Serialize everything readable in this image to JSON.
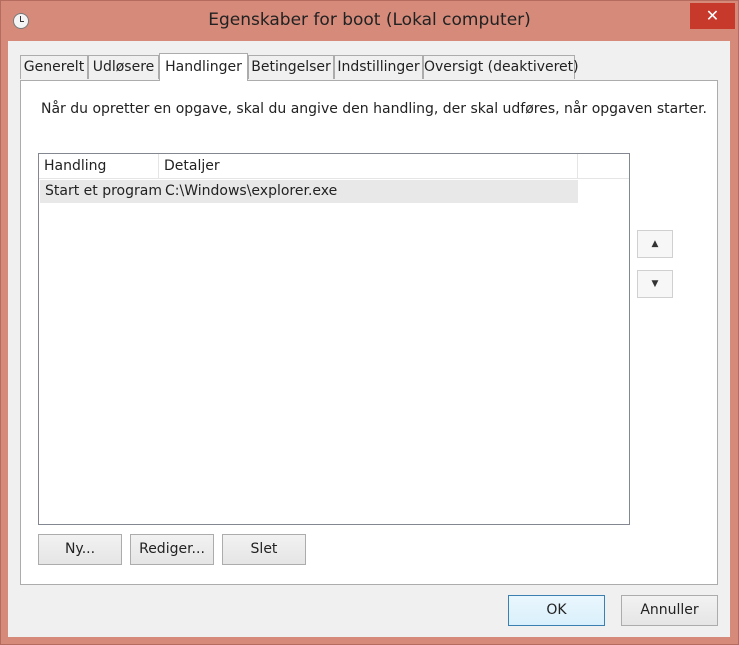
{
  "window": {
    "title": "Egenskaber for boot (Lokal computer)",
    "close_symbol": "✕"
  },
  "tabs": [
    {
      "label": "Generelt",
      "active": false
    },
    {
      "label": "Udløsere",
      "active": false
    },
    {
      "label": "Handlinger",
      "active": true
    },
    {
      "label": "Betingelser",
      "active": false
    },
    {
      "label": "Indstillinger",
      "active": false
    },
    {
      "label": "Oversigt (deaktiveret)",
      "active": false
    }
  ],
  "panel": {
    "description": "Når du opretter en opgave, skal du angive den handling, der skal udføres, når opgaven starter."
  },
  "actions_table": {
    "columns": [
      "Handling",
      "Detaljer"
    ],
    "rows": [
      {
        "action": "Start et program",
        "details": "C:\\Windows\\explorer.exe",
        "selected": true
      }
    ]
  },
  "move_buttons": {
    "up_symbol": "▲",
    "down_symbol": "▼"
  },
  "action_buttons": {
    "new": "Ny...",
    "edit": "Rediger...",
    "delete": "Slet"
  },
  "dialog_buttons": {
    "ok": "OK",
    "cancel": "Annuller"
  },
  "colors": {
    "window_frame": "#d58a7a",
    "close_button": "#c7392a",
    "default_button_border": "#3c7fb1",
    "selected_row": "#e8e8e8"
  }
}
